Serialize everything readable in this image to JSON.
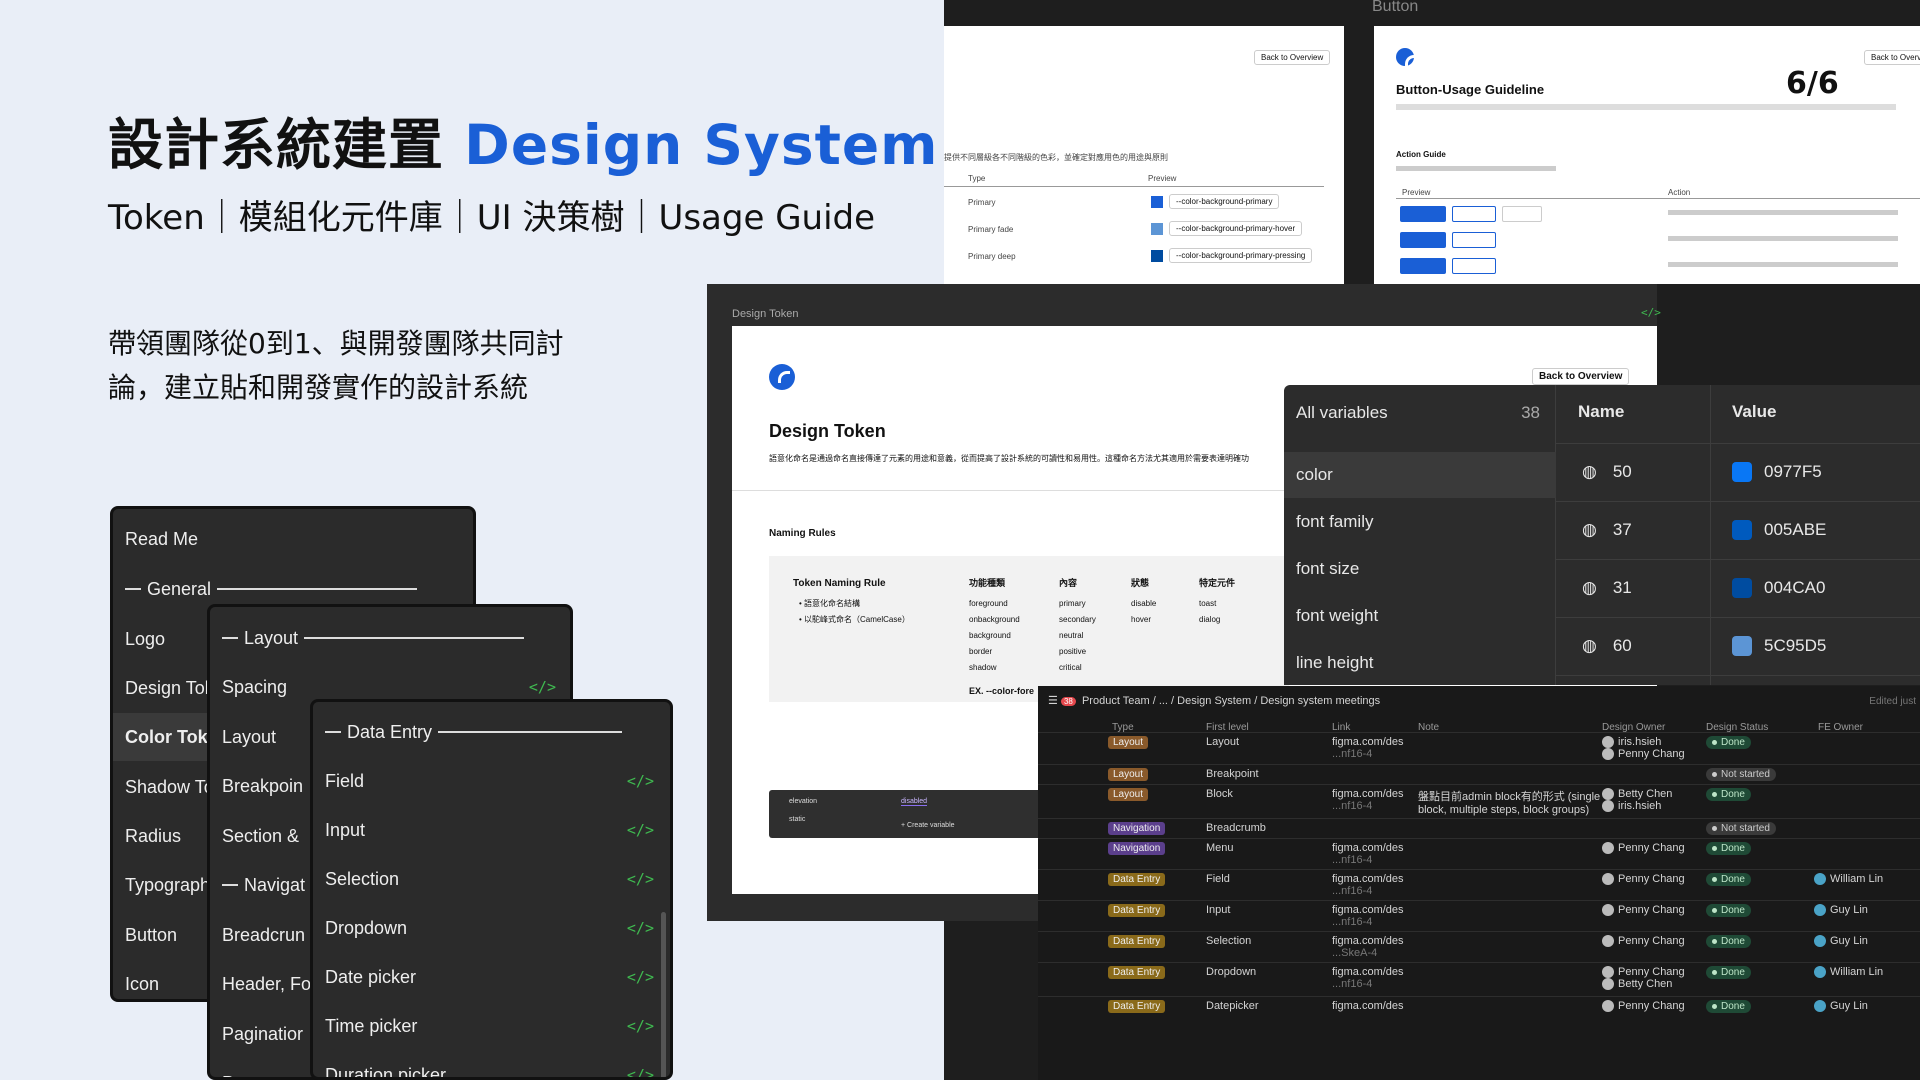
{
  "hero": {
    "title_zh": "設計系統建置",
    "title_en": "Design System",
    "subtitle": "Token｜模組化元件庫｜UI 決策樹｜Usage Guide",
    "desc_line1": "帶領團隊從0到1、與開發團隊共同討",
    "desc_line2": "論，建立貼和開發實作的設計系統"
  },
  "colors": {
    "accent": "#1a5fd6",
    "background": "#e9eef7",
    "dark": "#1e1e1e"
  },
  "panel1": {
    "items": [
      "Read Me",
      "General",
      "Logo",
      "Design Tok",
      "Color Toke",
      "Shadow To",
      "Radius",
      "Typograph",
      "Button",
      "Icon"
    ]
  },
  "panel2": {
    "items": [
      "Layout",
      "Spacing",
      "Layout",
      "Breakpoin",
      "Section &",
      "Navigat",
      "Breadcrun",
      "Header, Fo",
      "Paginatior",
      "Progress"
    ]
  },
  "panel3": {
    "items": [
      "Data Entry",
      "Field",
      "Input",
      "Selection",
      "Dropdown",
      "Date picker",
      "Time picker",
      "Duration picker"
    ]
  },
  "top_frames": {
    "button_label": "Button",
    "back_to_overview": "Back to Overview",
    "button_usage_title": "Button-Usage Guideline",
    "page_counter": "6/6",
    "type_col": "Type",
    "preview_col": "Preview",
    "rows": [
      "Primary",
      "Primary fade",
      "Primary deep"
    ],
    "tokens": [
      "--color-background-primary",
      "--color-background-primary-hover",
      "--color-background-primary-pressing"
    ],
    "action_guide": "Action Guide",
    "preview_label": "Preview",
    "action_label": "Action"
  },
  "design_token": {
    "frame_label": "Design Token",
    "heading": "Design Token",
    "back": "Back to Overview",
    "intro": "語意化命名是通過命名直接傳達了元素的用途和意義，從而提高了設計系統的可讀性和易用性。這種命名方法尤其適用於需要表達明確功",
    "naming_rules": "Naming Rules",
    "token_naming_rule": "Token Naming Rule",
    "rule1": "語意化命名結構",
    "rule2": "以駝峰式命名（CamelCase）",
    "cols": [
      "功能種類",
      "內容",
      "狀態",
      "特定元件"
    ],
    "col1_vals": [
      "foreground",
      "onbackground",
      "background",
      "border",
      "shadow"
    ],
    "col2_vals": [
      "primary",
      "secondary",
      "neutral",
      "positive",
      "critical"
    ],
    "col3_vals": [
      "disable",
      "hover"
    ],
    "col4_vals": [
      "toast",
      "dialog"
    ],
    "example": "EX. --color-fore",
    "elevation": "elevation",
    "static": "static",
    "disabled": "disabled",
    "create_variable": "Create variable"
  },
  "variables": {
    "all_label": "All variables",
    "count": "38",
    "groups": [
      "color",
      "font family",
      "font size",
      "font weight",
      "line height"
    ],
    "name_header": "Name",
    "value_header": "Value",
    "rows": [
      {
        "name": "50",
        "value": "0977F5",
        "color": "#0977F5"
      },
      {
        "name": "37",
        "value": "005ABE",
        "color": "#005ABE"
      },
      {
        "name": "31",
        "value": "004CA0",
        "color": "#004CA0"
      },
      {
        "name": "60",
        "value": "5C95D5",
        "color": "#5C95D5"
      }
    ]
  },
  "notion": {
    "badge": "38",
    "breadcrumb": [
      "Product Team",
      "...",
      "Design System",
      "Design system meetings"
    ],
    "edited": "Edited just",
    "columns": [
      "Type",
      "First level",
      "Link",
      "Note",
      "Design Owner",
      "Design Status",
      "FE Owner"
    ],
    "rows": [
      {
        "type": "Layout",
        "kind": "layout",
        "first": "Layout",
        "link": "figma.com/des",
        "link2": "...nf16-4",
        "note": "",
        "owners": [
          "iris.hsieh",
          "Penny Chang"
        ],
        "status": "Done",
        "fe": ""
      },
      {
        "type": "Layout",
        "kind": "layout",
        "first": "Breakpoint",
        "link": "",
        "link2": "",
        "note": "",
        "owners": [],
        "status": "Not started",
        "fe": ""
      },
      {
        "type": "Layout",
        "kind": "layout",
        "first": "Block",
        "link": "figma.com/des",
        "link2": "...nf16-4",
        "note": "盤點目前admin block有的形式 (single block, multiple steps, block groups)",
        "owners": [
          "Betty Chen",
          "iris.hsieh"
        ],
        "status": "Done",
        "fe": ""
      },
      {
        "type": "Navigation",
        "kind": "nav",
        "first": "Breadcrumb",
        "link": "",
        "link2": "",
        "note": "",
        "owners": [],
        "status": "Not started",
        "fe": ""
      },
      {
        "type": "Navigation",
        "kind": "nav",
        "first": "Menu",
        "link": "figma.com/des",
        "link2": "...nf16-4",
        "note": "",
        "owners": [
          "Penny Chang"
        ],
        "status": "Done",
        "fe": ""
      },
      {
        "type": "Data Entry",
        "kind": "entry",
        "first": "Field",
        "link": "figma.com/des",
        "link2": "...nf16-4",
        "note": "",
        "owners": [
          "Penny Chang"
        ],
        "status": "Done",
        "fe": "William Lin"
      },
      {
        "type": "Data Entry",
        "kind": "entry",
        "first": "Input",
        "link": "figma.com/des",
        "link2": "...nf16-4",
        "note": "",
        "owners": [
          "Penny Chang"
        ],
        "status": "Done",
        "fe": "Guy Lin"
      },
      {
        "type": "Data Entry",
        "kind": "entry",
        "first": "Selection",
        "link": "figma.com/des",
        "link2": "...SkeA-4",
        "note": "",
        "owners": [
          "Penny Chang"
        ],
        "status": "Done",
        "fe": "Guy Lin"
      },
      {
        "type": "Data Entry",
        "kind": "entry",
        "first": "Dropdown",
        "link": "figma.com/des",
        "link2": "...nf16-4",
        "note": "",
        "owners": [
          "Penny Chang",
          "Betty Chen"
        ],
        "status": "Done",
        "fe": "William Lin"
      },
      {
        "type": "Data Entry",
        "kind": "entry",
        "first": "Datepicker",
        "link": "figma.com/des",
        "link2": "",
        "note": "",
        "owners": [
          "Penny Chang"
        ],
        "status": "Done",
        "fe": "Guy Lin"
      }
    ]
  }
}
